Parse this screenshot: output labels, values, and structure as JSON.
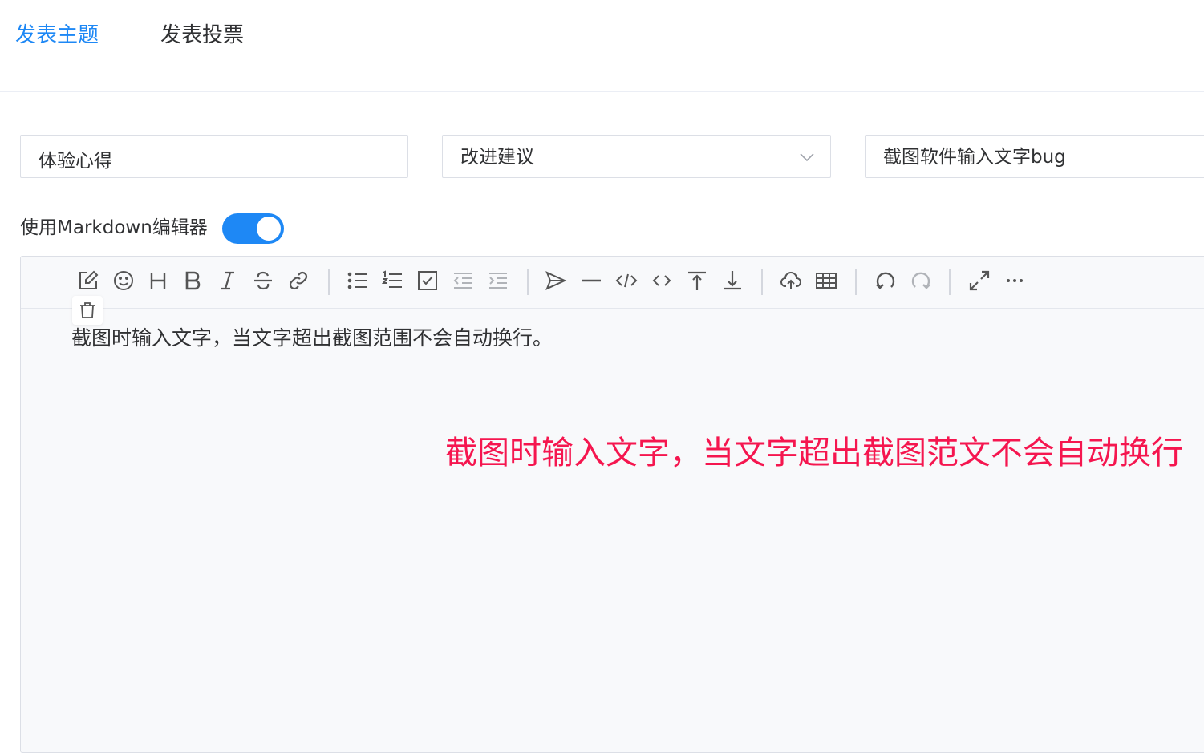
{
  "tabs": [
    {
      "label": "发表主题",
      "active": true
    },
    {
      "label": "发表投票",
      "active": false
    }
  ],
  "form": {
    "category_value": "体验心得",
    "type_value": "改进建议",
    "title_value": "截图软件输入文字bug"
  },
  "markdown": {
    "label": "使用Markdown编辑器",
    "enabled": true
  },
  "toolbar": {
    "icons": [
      "edit-icon",
      "emoji-icon",
      "heading-icon",
      "bold-icon",
      "italic-icon",
      "strikethrough-icon",
      "link-icon",
      "unordered-list-icon",
      "ordered-list-icon",
      "checklist-icon",
      "outdent-icon",
      "indent-icon",
      "quote-icon",
      "horizontal-rule-icon",
      "code-block-icon",
      "inline-code-icon",
      "insert-before-icon",
      "insert-after-icon",
      "upload-icon",
      "table-icon",
      "undo-icon",
      "redo-icon",
      "fullscreen-icon",
      "more-icon",
      "trash-icon"
    ]
  },
  "editor": {
    "content": "截图时输入文字，当文字超出截图范围不会自动换行。",
    "annotation": "截图时输入文字，当文字超出截图范文不会自动换行"
  },
  "colors": {
    "accent": "#1e88f5",
    "annotation": "#f5164f"
  }
}
